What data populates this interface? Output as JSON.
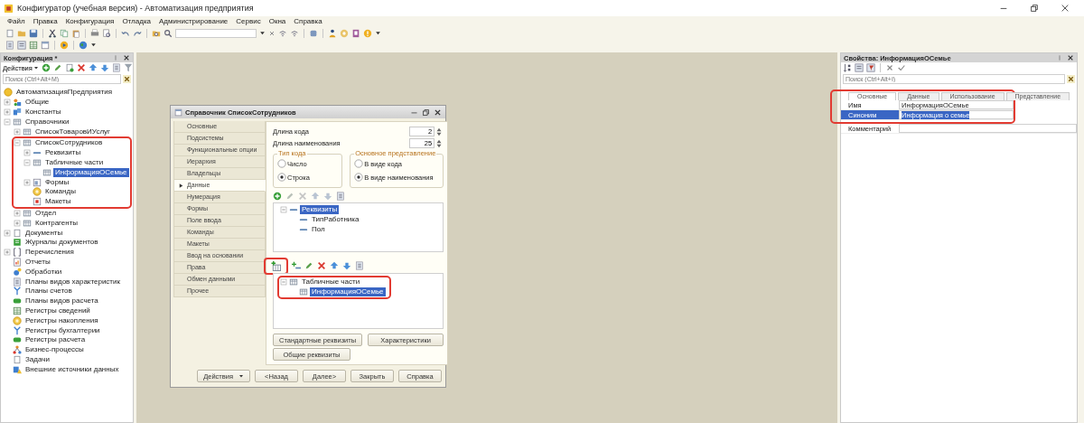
{
  "window": {
    "title": "Конфигуратор (учебная версия) - Автоматизация предприятия"
  },
  "menu": [
    "Файл",
    "Правка",
    "Конфигурация",
    "Отладка",
    "Администрирование",
    "Сервис",
    "Окна",
    "Справка"
  ],
  "config": {
    "title": "Конфигурация *",
    "actions_label": "Действия",
    "search_placeholder": "Поиск (Ctrl+Alt+M)",
    "tree": [
      {
        "label": "АвтоматизацияПредприятия",
        "selected": false,
        "children": [
          {
            "label": "Общие",
            "expanded": false,
            "selected": false
          },
          {
            "label": "Константы",
            "expanded": false,
            "selected": false
          },
          {
            "label": "Справочники",
            "expanded": true,
            "selected": false,
            "children": [
              {
                "label": "СписокТоваровИУслуг",
                "expanded": false,
                "selected": false
              },
              {
                "label": "СписокСотрудников",
                "expanded": true,
                "selected": false,
                "highlighted": true,
                "children": [
                  {
                    "label": "Реквизиты",
                    "expanded": false,
                    "selected": false
                  },
                  {
                    "label": "Табличные части",
                    "expanded": true,
                    "selected": false,
                    "children": [
                      {
                        "label": "ИнформацияОСемье",
                        "selected": true
                      }
                    ]
                  },
                  {
                    "label": "Формы",
                    "expanded": false,
                    "selected": false
                  },
                  {
                    "label": "Команды",
                    "selected": false
                  },
                  {
                    "label": "Макеты",
                    "selected": false
                  }
                ]
              },
              {
                "label": "Отдел",
                "expanded": false,
                "selected": false
              },
              {
                "label": "Контрагенты",
                "expanded": false,
                "selected": false
              }
            ]
          },
          {
            "label": "Документы",
            "expanded": false,
            "selected": false
          },
          {
            "label": "Журналы документов",
            "selected": false
          },
          {
            "label": "Перечисления",
            "expanded": false,
            "selected": false
          },
          {
            "label": "Отчеты",
            "selected": false
          },
          {
            "label": "Обработки",
            "selected": false
          },
          {
            "label": "Планы видов характеристик",
            "selected": false
          },
          {
            "label": "Планы счетов",
            "selected": false
          },
          {
            "label": "Планы видов расчета",
            "selected": false
          },
          {
            "label": "Регистры сведений",
            "selected": false
          },
          {
            "label": "Регистры накопления",
            "selected": false
          },
          {
            "label": "Регистры бухгалтерии",
            "selected": false
          },
          {
            "label": "Регистры расчета",
            "selected": false
          },
          {
            "label": "Бизнес-процессы",
            "selected": false
          },
          {
            "label": "Задачи",
            "selected": false
          },
          {
            "label": "Внешние источники данных",
            "selected": false
          }
        ]
      }
    ]
  },
  "dialog": {
    "title": "Справочник СписокСотрудников",
    "nav": [
      {
        "label": "Основные",
        "selected": false
      },
      {
        "label": "Подсистемы",
        "selected": false
      },
      {
        "label": "Функциональные опции",
        "selected": false
      },
      {
        "label": "Иерархия",
        "selected": false
      },
      {
        "label": "Владельцы",
        "selected": false
      },
      {
        "label": "Данные",
        "selected": true
      },
      {
        "label": "Нумерация",
        "selected": false
      },
      {
        "label": "Формы",
        "selected": false
      },
      {
        "label": "Поле ввода",
        "selected": false
      },
      {
        "label": "Команды",
        "selected": false
      },
      {
        "label": "Макеты",
        "selected": false
      },
      {
        "label": "Ввод на основании",
        "selected": false
      },
      {
        "label": "Права",
        "selected": false
      },
      {
        "label": "Обмен данными",
        "selected": false
      },
      {
        "label": "Прочее",
        "selected": false
      }
    ],
    "code_length": {
      "label": "Длина кода",
      "value": "2"
    },
    "name_length": {
      "label": "Длина наименования",
      "value": "25"
    },
    "code_type": {
      "title": "Тип кода",
      "options": [
        {
          "label": "Число",
          "selected": false
        },
        {
          "label": "Строка",
          "selected": true
        }
      ]
    },
    "main_view": {
      "title": "Основное представление",
      "options": [
        {
          "label": "В виде кода",
          "selected": false
        },
        {
          "label": "В виде наименования",
          "selected": true
        }
      ]
    },
    "attributes_tree": [
      {
        "label": "Реквизиты",
        "expanded": true,
        "selected": true,
        "children": [
          {
            "label": "ТипРаботника",
            "selected": false
          },
          {
            "label": "Пол",
            "selected": false
          }
        ]
      }
    ],
    "add_highlighted": true,
    "tabular_tree": [
      {
        "label": "Табличные части",
        "expanded": true,
        "selected": false,
        "highlighted": true,
        "children": [
          {
            "label": "ИнформацияОСемье",
            "selected": true
          }
        ]
      }
    ],
    "buttons": [
      "Стандартные реквизиты",
      "Характеристики",
      "Общие реквизиты"
    ],
    "footer": [
      {
        "label": "Действия",
        "kind": "dropdown"
      },
      {
        "label": "<Назад",
        "kind": "plain"
      },
      {
        "label": "Далее>",
        "kind": "plain"
      },
      {
        "label": "Закрыть",
        "kind": "plain"
      },
      {
        "label": "Справка",
        "kind": "plain"
      }
    ]
  },
  "properties": {
    "title": "Свойства: ИнформацияОСемье",
    "search_placeholder": "Поиск (Ctrl+Alt+I)",
    "highlighted": true,
    "tabs": [
      {
        "label": "Основные",
        "selected": true
      },
      {
        "label": "Данные",
        "selected": false
      },
      {
        "label": "Использование",
        "selected": false
      },
      {
        "label": "Представление",
        "selected": false
      }
    ],
    "rows": [
      {
        "label": "Имя",
        "value": "ИнформацияОСемье",
        "selected": false
      },
      {
        "label": "Синоним",
        "value": "Информация о семье",
        "selected": true
      },
      {
        "label": "Комментарий",
        "selected": false
      }
    ]
  }
}
